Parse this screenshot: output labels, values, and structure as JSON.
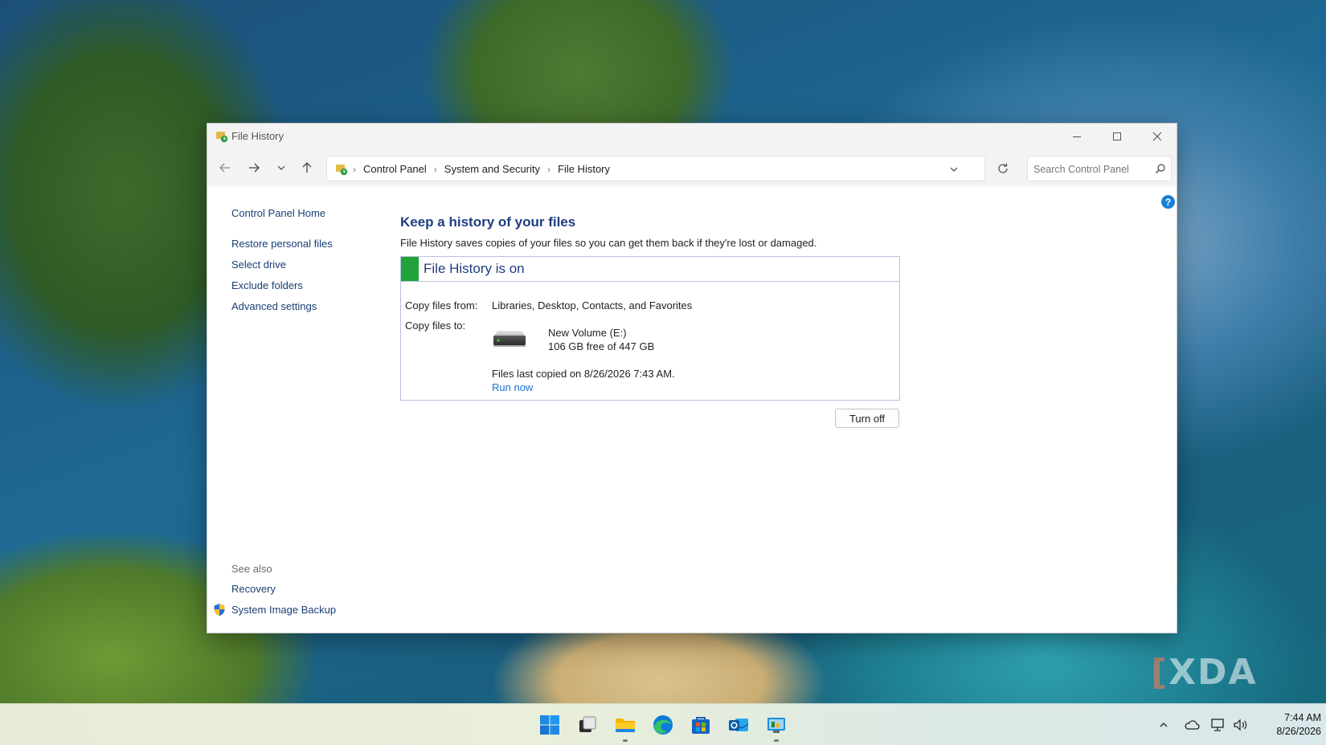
{
  "window": {
    "title": "File History"
  },
  "navbar": {
    "breadcrumbs": [
      "Control Panel",
      "System and Security",
      "File History"
    ],
    "search_placeholder": "Search Control Panel"
  },
  "help": {
    "label": "?"
  },
  "sidebar": {
    "home": "Control Panel Home",
    "links": [
      "Restore personal files",
      "Select drive",
      "Exclude folders",
      "Advanced settings"
    ],
    "see_also_heading": "See also",
    "see_also": [
      "Recovery",
      "System Image Backup"
    ]
  },
  "main": {
    "heading": "Keep a history of your files",
    "description": "File History saves copies of your files so you can get them back if they're lost or damaged.",
    "status": {
      "title": "File History is on",
      "stripe_color": "#1fa33a",
      "copy_from_label": "Copy files from:",
      "copy_from_value": "Libraries, Desktop, Contacts, and Favorites",
      "copy_to_label": "Copy files to:",
      "drive_name": "New Volume (E:)",
      "drive_free": "106 GB free of 447 GB",
      "last_copied": "Files last copied on 8/26/2026 7:43 AM.",
      "run_now": "Run now"
    },
    "turn_off_label": "Turn off"
  },
  "taskbar": {
    "apps": [
      "start-icon",
      "task-view-icon",
      "file-explorer-icon",
      "edge-icon",
      "store-icon",
      "outlook-icon",
      "control-panel-icon"
    ],
    "time": "7:44 AM",
    "date": "8/26/2026"
  },
  "watermark": "XDA",
  "colors": {
    "accent_blue": "#1e3d80",
    "link_blue": "#1a6fd1",
    "status_green": "#1fa33a"
  }
}
